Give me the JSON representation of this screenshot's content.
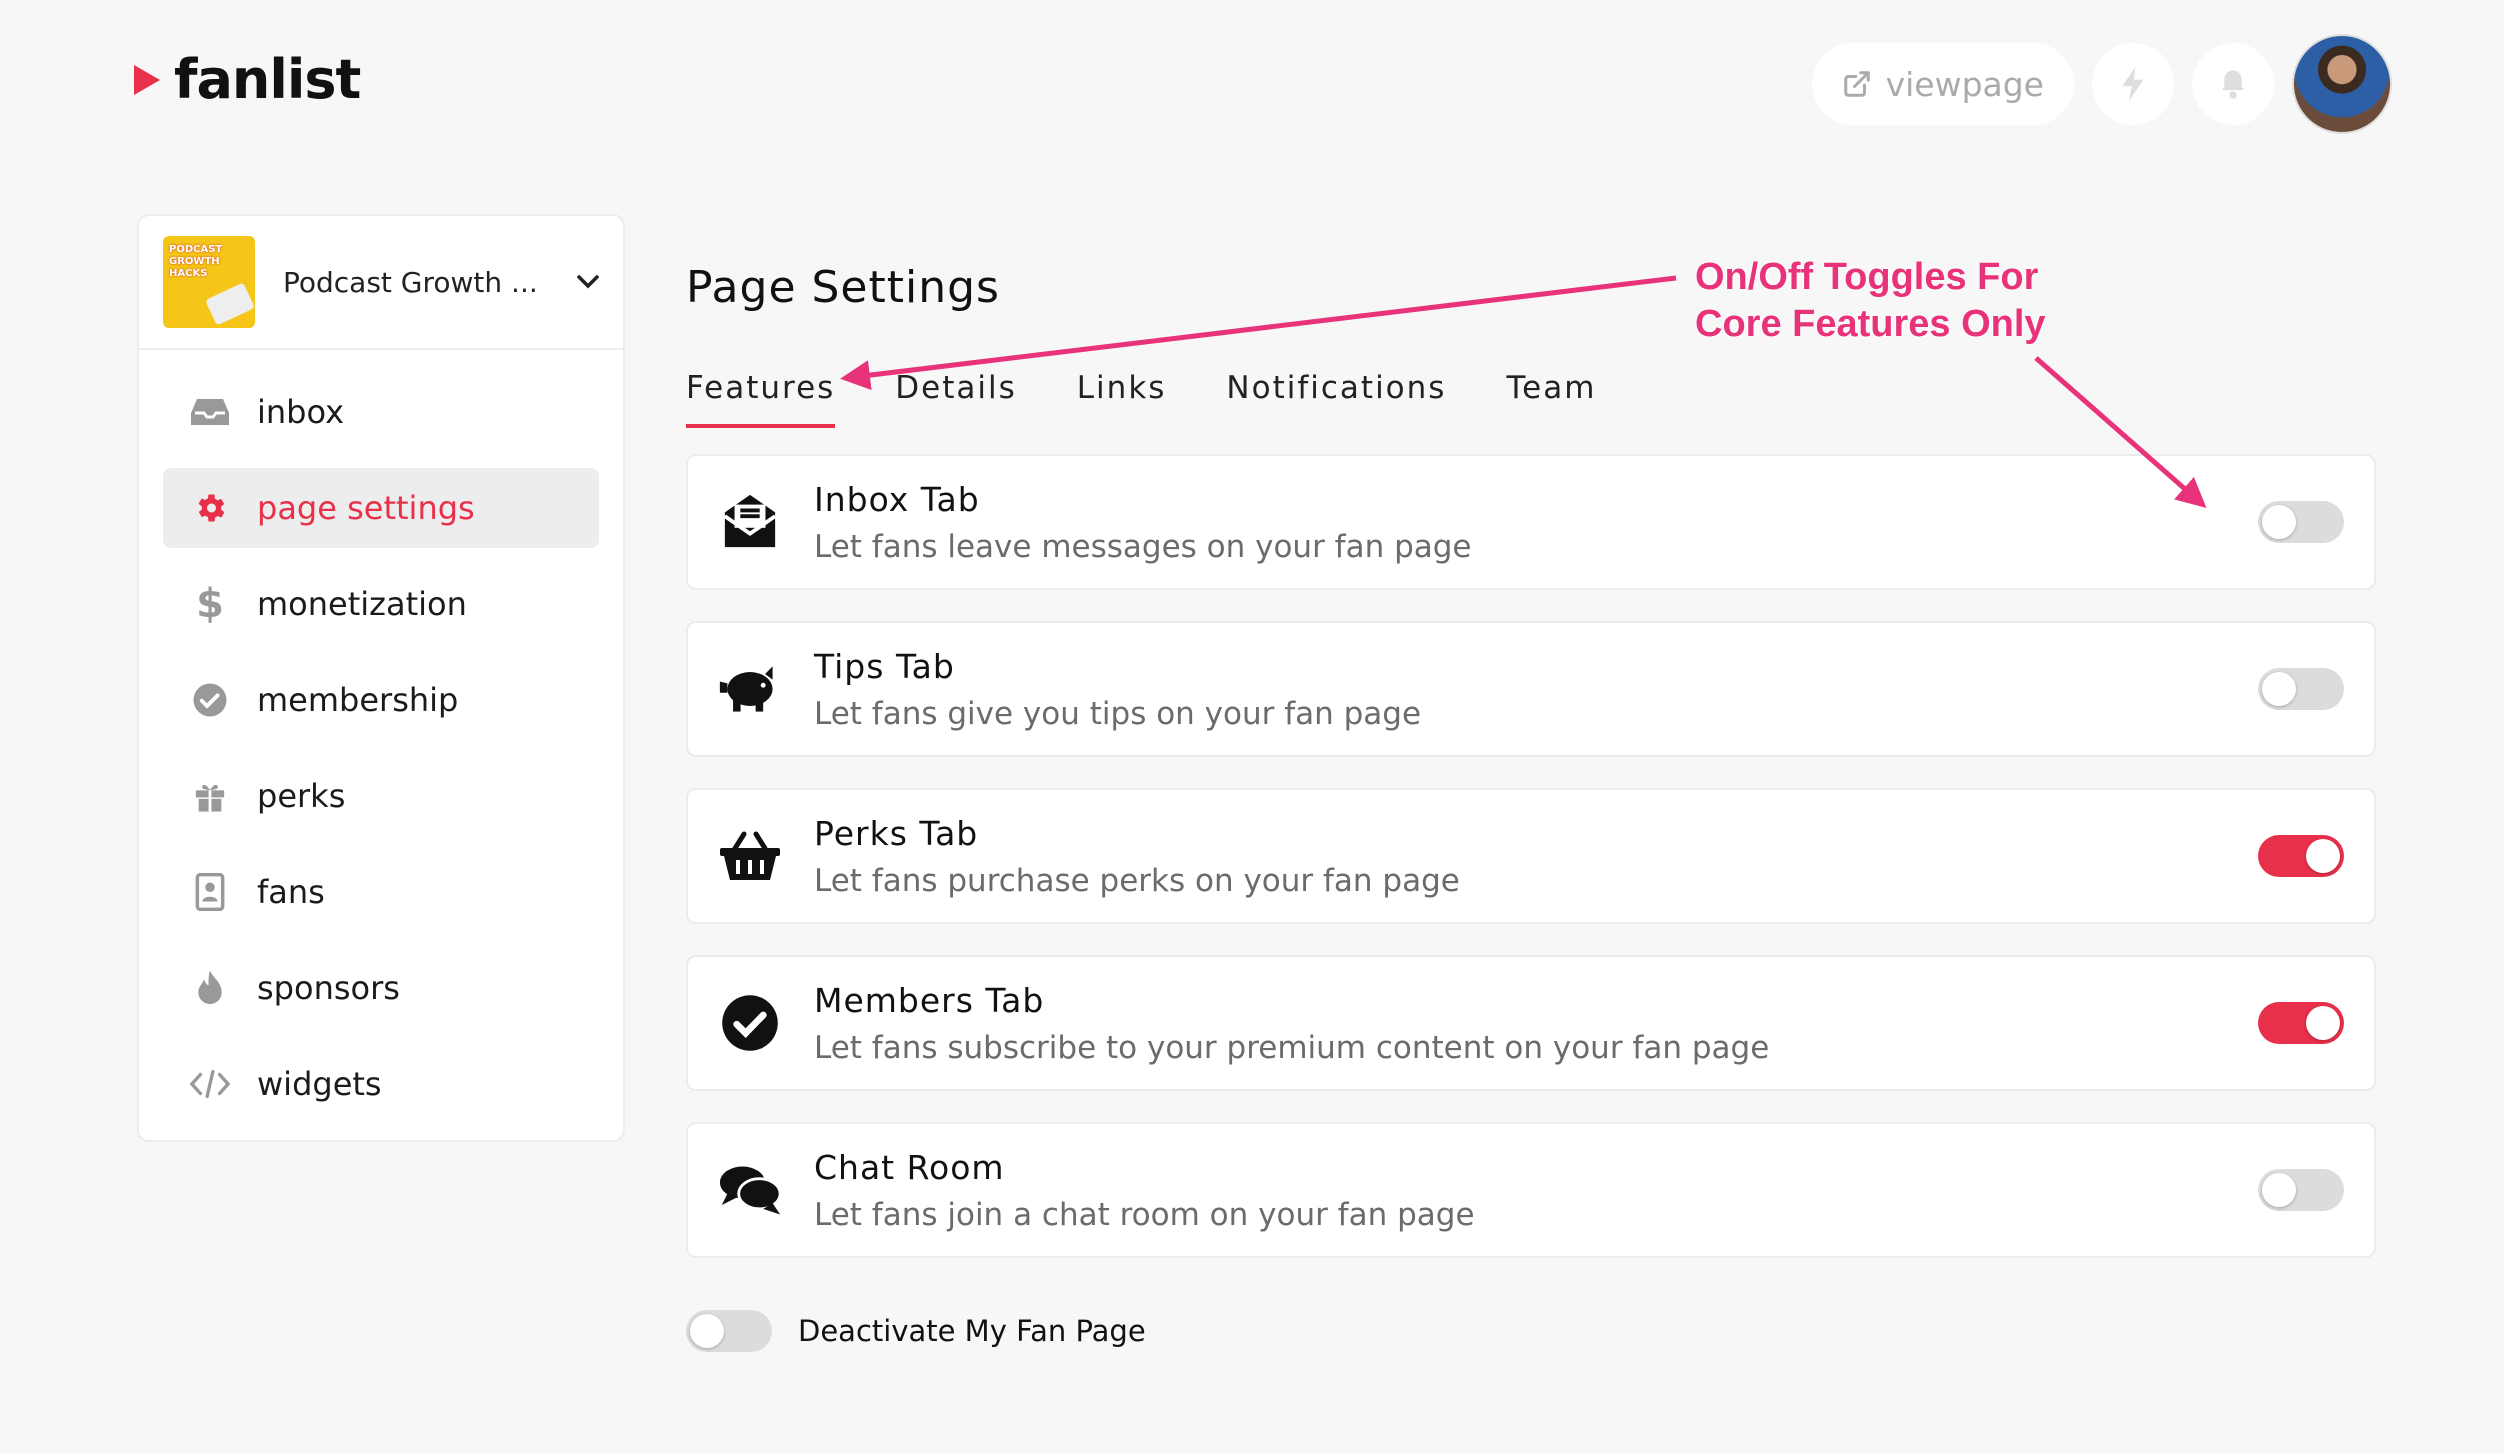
{
  "header": {
    "brand": "fanlist",
    "viewpage_label": "viewpage"
  },
  "sidebar": {
    "account_name": "Podcast Growth ...",
    "account_thumb_text": "PODCAST GROWTH HACKS",
    "items": [
      {
        "label": "inbox",
        "icon": "inbox-icon"
      },
      {
        "label": "page settings",
        "icon": "gear-icon",
        "active": true
      },
      {
        "label": "monetization",
        "icon": "dollar-icon"
      },
      {
        "label": "membership",
        "icon": "check-circle-icon"
      },
      {
        "label": "perks",
        "icon": "gift-icon"
      },
      {
        "label": "fans",
        "icon": "contact-card-icon"
      },
      {
        "label": "sponsors",
        "icon": "flame-icon"
      },
      {
        "label": "widgets",
        "icon": "code-icon"
      }
    ]
  },
  "main": {
    "title": "Page Settings",
    "tabs": [
      "Features",
      "Details",
      "Links",
      "Notifications",
      "Team"
    ],
    "active_tab": "Features",
    "features": [
      {
        "title": "Inbox Tab",
        "description": "Let fans leave messages on your fan page",
        "enabled": false
      },
      {
        "title": "Tips Tab",
        "description": "Let fans give you tips on your fan page",
        "enabled": false
      },
      {
        "title": "Perks Tab",
        "description": "Let fans purchase perks on your fan page",
        "enabled": true
      },
      {
        "title": "Members Tab",
        "description": "Let fans subscribe to your premium content on your fan page",
        "enabled": true
      },
      {
        "title": "Chat Room",
        "description": "Let fans join a chat room on your fan page",
        "enabled": false
      }
    ],
    "deactivate_label": "Deactivate My Fan Page",
    "deactivate_enabled": false
  },
  "annotation": {
    "line1": "On/Off Toggles For",
    "line2": "Core Features Only"
  },
  "colors": {
    "accent": "#e9304b",
    "annotation": "#e8337a",
    "background": "#f7f7f7"
  }
}
